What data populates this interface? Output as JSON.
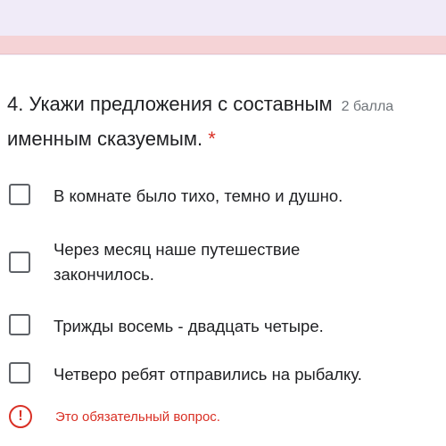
{
  "question": {
    "title_line1": "4. Укажи предложения с составным",
    "points": "2 балла",
    "title_line2": "именным сказуемым.",
    "required_mark": "*"
  },
  "options": [
    {
      "label": "В комнате было тихо, темно и душно.",
      "checked": false
    },
    {
      "label": "Через месяц наше путешествие закончилось.",
      "checked": false
    },
    {
      "label": "Трижды восемь - двадцать четыре.",
      "checked": false
    },
    {
      "label": "Четверо ребят отправились на рыбалку.",
      "checked": false
    }
  ],
  "error": {
    "icon": "exclamation-icon",
    "icon_glyph": "!",
    "message": "Это обязательный вопрос."
  },
  "colors": {
    "error": "#d93025",
    "text": "#202124",
    "muted": "#70757a"
  }
}
